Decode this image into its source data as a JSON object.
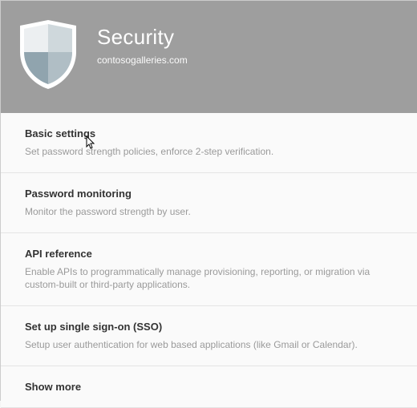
{
  "header": {
    "title": "Security",
    "domain": "contosogalleries.com",
    "icon": "shield-icon"
  },
  "items": [
    {
      "title": "Basic settings",
      "desc": "Set password strength policies, enforce 2-step verification."
    },
    {
      "title": "Password monitoring",
      "desc": "Monitor the password strength by user."
    },
    {
      "title": "API reference",
      "desc": "Enable APIs to programmatically manage provisioning, reporting, or migration via custom-built or third-party applications."
    },
    {
      "title": "Set up single sign-on (SSO)",
      "desc": "Setup user authentication for web based applications (like Gmail or Calendar)."
    }
  ],
  "show_more": "Show more"
}
